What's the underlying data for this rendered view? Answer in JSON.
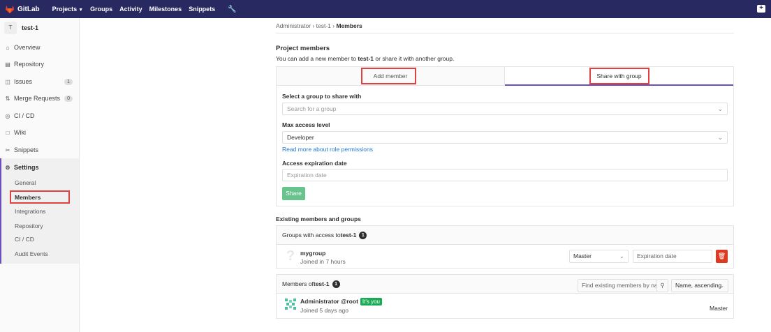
{
  "navbar": {
    "brand": "GitLab",
    "links": [
      "Projects",
      "Groups",
      "Activity",
      "Milestones",
      "Snippets"
    ]
  },
  "sidebar": {
    "project_initial": "T",
    "project_name": "test-1",
    "items": [
      {
        "label": "Overview",
        "icon": "home-icon"
      },
      {
        "label": "Repository",
        "icon": "book-icon"
      },
      {
        "label": "Issues",
        "icon": "issues-icon",
        "count": "1"
      },
      {
        "label": "Merge Requests",
        "icon": "merge-request-icon",
        "count": "0"
      },
      {
        "label": "CI / CD",
        "icon": "rocket-icon"
      },
      {
        "label": "Wiki",
        "icon": "wiki-icon"
      },
      {
        "label": "Snippets",
        "icon": "scissors-icon"
      },
      {
        "label": "Settings",
        "icon": "gear-icon"
      }
    ],
    "settings_sub": [
      "General",
      "Members",
      "Integrations",
      "Repository",
      "CI / CD",
      "Audit Events"
    ]
  },
  "breadcrumb": {
    "a": "Administrator",
    "b": "test-1",
    "c": "Members"
  },
  "page": {
    "title": "Project members",
    "desc_pre": "You can add a new member to ",
    "desc_proj": "test-1",
    "desc_post": " or share it with another group."
  },
  "tabs": {
    "add": "Add member",
    "share": "Share with group"
  },
  "form": {
    "group_label": "Select a group to share with",
    "group_placeholder": "Search for a group",
    "access_label": "Max access level",
    "access_value": "Developer",
    "read_more": "Read more",
    "read_more_rest": " about role permissions",
    "expiry_label": "Access expiration date",
    "expiry_placeholder": "Expiration date",
    "share_button": "Share"
  },
  "existing": {
    "title": "Existing members and groups",
    "groups_head_pre": "Groups with access to ",
    "groups_head_proj": "test-1",
    "groups_count": "1",
    "group_name": "mygroup",
    "group_joined": "Joined in 7 hours",
    "group_role": "Master",
    "group_expiry_placeholder": "Expiration date",
    "members_head_pre": "Members of ",
    "members_head_proj": "test-1",
    "members_count": "1",
    "search_placeholder": "Find existing members by name",
    "sort_value": "Name, ascending",
    "member_name": "Administrator @root",
    "member_badge": "It's you",
    "member_joined": "Joined 5 days ago",
    "member_role": "Master"
  }
}
